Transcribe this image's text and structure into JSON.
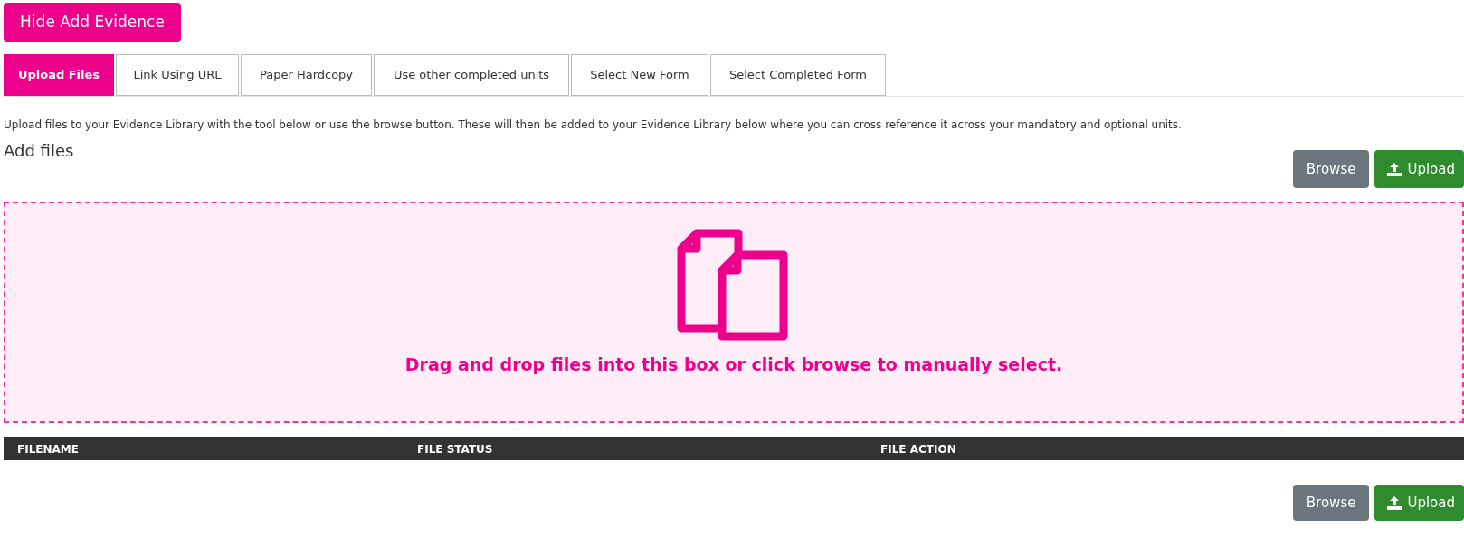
{
  "toggle_button": "Hide Add Evidence",
  "tabs": [
    {
      "label": "Upload Files",
      "selected": true
    },
    {
      "label": "Link Using URL",
      "selected": false
    },
    {
      "label": "Paper Hardcopy",
      "selected": false
    },
    {
      "label": "Use other completed units",
      "selected": false
    },
    {
      "label": "Select New Form",
      "selected": false
    },
    {
      "label": "Select Completed Form",
      "selected": false
    }
  ],
  "description": "Upload files to your Evidence Library with the tool below or use the browse button. These will then be added to your Evidence Library below where you can cross reference it across your mandatory and optional units.",
  "heading": "Add files",
  "top_buttons": {
    "browse": "Browse",
    "upload": "Upload"
  },
  "drop_zone": {
    "text": "Drag and drop files into this box or click browse to manually select."
  },
  "table": {
    "columns": [
      "FILENAME",
      "FILE STATUS",
      "FILE ACTION"
    ]
  },
  "bottom_buttons": {
    "browse": "Browse",
    "upload": "Upload"
  }
}
